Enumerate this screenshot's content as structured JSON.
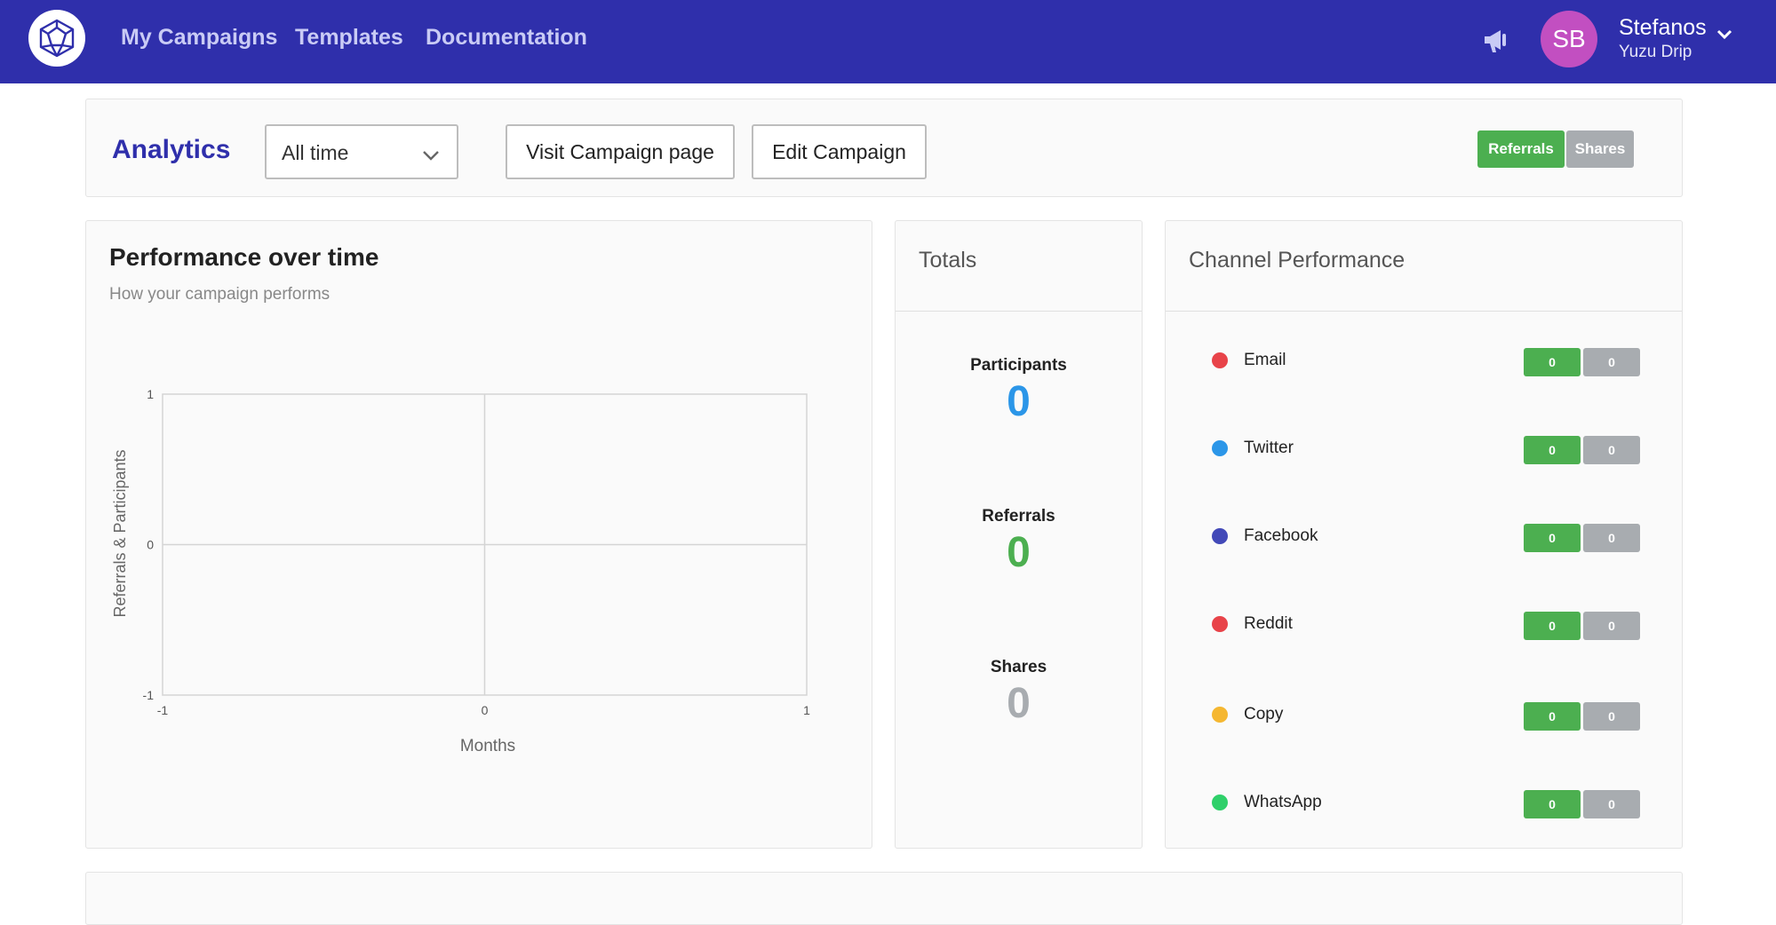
{
  "nav": {
    "links": [
      "My Campaigns",
      "Templates",
      "Documentation"
    ],
    "user": {
      "initials": "SB",
      "name": "Stefanos",
      "org": "Yuzu Drip"
    }
  },
  "analytics": {
    "title": "Analytics",
    "time_range": "All time",
    "visit_button": "Visit Campaign page",
    "edit_button": "Edit Campaign",
    "toggle_referrals": "Referrals",
    "toggle_shares": "Shares"
  },
  "performance": {
    "title": "Performance over time",
    "subtitle": "How your campaign performs"
  },
  "chart_data": {
    "type": "line",
    "title": "Performance over time",
    "xlabel": "Months",
    "ylabel": "Referrals & Participants",
    "xlim": [
      -1,
      1
    ],
    "ylim": [
      -1,
      1
    ],
    "x_ticks": [
      "-1",
      "0",
      "1"
    ],
    "y_ticks": [
      "1",
      "0",
      "-1"
    ],
    "series": [],
    "grid": true
  },
  "totals": {
    "title": "Totals",
    "items": [
      {
        "label": "Participants",
        "value": "0"
      },
      {
        "label": "Referrals",
        "value": "0"
      },
      {
        "label": "Shares",
        "value": "0"
      }
    ]
  },
  "channels": {
    "title": "Channel Performance",
    "items": [
      {
        "name": "Email",
        "referrals": "0",
        "shares": "0",
        "color": "#e84349"
      },
      {
        "name": "Twitter",
        "referrals": "0",
        "shares": "0",
        "color": "#2b96e8"
      },
      {
        "name": "Facebook",
        "referrals": "0",
        "shares": "0",
        "color": "#4249b8"
      },
      {
        "name": "Reddit",
        "referrals": "0",
        "shares": "0",
        "color": "#e84349"
      },
      {
        "name": "Copy",
        "referrals": "0",
        "shares": "0",
        "color": "#f5b731"
      },
      {
        "name": "WhatsApp",
        "referrals": "0",
        "shares": "0",
        "color": "#2fd06a"
      }
    ]
  },
  "colors": {
    "nav_bg": "#2f2fab",
    "accent": "#2f2fab",
    "green": "#4caf50",
    "gray": "#a8acb0",
    "participants": "#2b96e8",
    "referrals": "#4caf50",
    "shares": "#a8acb0"
  },
  "icons": {
    "logo": "polyhedron-logo-icon",
    "notifications": "megaphone-icon",
    "user_menu": "chevron-down-icon",
    "time_select": "chevron-down-icon"
  }
}
